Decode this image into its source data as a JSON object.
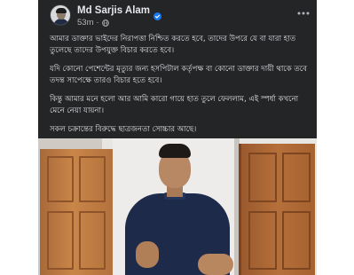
{
  "post": {
    "author": {
      "name": "Md Sarjis Alam",
      "verified": true
    },
    "timestamp": "53m",
    "separator": "·",
    "audience_icon": "globe-icon",
    "paragraphs": [
      "আমার ডাক্তার ভাইদের নিরাপত্তা নিশ্চিত করতে হবে, তাদের উপরে যে বা যারা হাত তুলেছে তাদের উপযুক্ত বিচার করতে হবে।",
      "যদি কোনো পেশেন্টের মৃত্যুর জন্য হসপিটাল কর্তৃপক্ষ বা কোনো ডাক্তার দায়ী থাকে তবে তদন্ত সাপেক্ষে তারও বিচার হতে হবে।",
      "কিন্তু আমার মনে হলো আর আমি কারো গায়ে হাত তুলে ফেললাম, এই স্পর্ধা কখনো মেনে নেয়া যায়না।",
      "সকল চক্রান্তের বিরুদ্ধে ছাত্রজনতা সোচ্চার আছে।"
    ],
    "media": "video-frame"
  },
  "colors": {
    "card_bg": "#242526",
    "text_primary": "#e4e6eb",
    "text_secondary": "#b0b3b8",
    "verified_blue": "#1877f2"
  }
}
